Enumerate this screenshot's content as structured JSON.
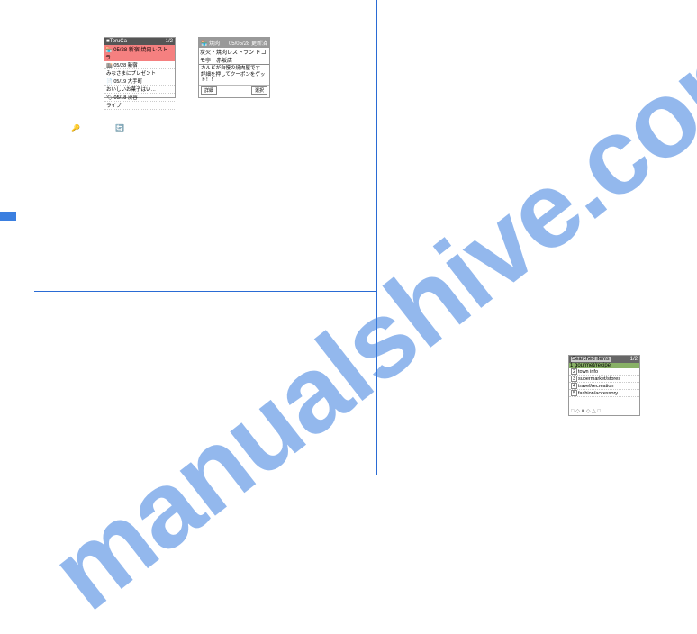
{
  "watermark": "manualshive.com",
  "ps1": {
    "titleLeft": "■ToruCa",
    "titleRight": "1/2",
    "hl": "🏪 05/28 新宿 焼肉レストラ…",
    "rows": [
      "🏬 05/28 新宿",
      "  みなさまにプレゼント",
      "📄 05/19 大手町",
      "  おいしいお菓子はい…",
      "🏷 05/18 渋谷",
      "  ライブ"
    ]
  },
  "ps2": {
    "titleLeft": "🏪 焼肉",
    "titleRight": "05/05/28 更新済",
    "hl": "炭火・焼肉レストラン ドコモ亭　赤坂店",
    "body": "カルビが自慢の焼肉屋です\n詳細を押してクーポンをゲット！！",
    "footLeft": "詳細",
    "footRight": "選択"
  },
  "ps3": {
    "titleLeft": "Searched items",
    "titleRight": "1/2",
    "hl": "1 gourmet/recipe",
    "rows": [
      {
        "n": "2",
        "t": "town info"
      },
      {
        "n": "3",
        "t": "supermarket/stores"
      },
      {
        "n": "4",
        "t": "travel/recreation"
      },
      {
        "n": "5",
        "t": "fashion/accessory"
      }
    ],
    "icons": "□ ◇ ■ ◇ △ □"
  },
  "miniIcons": {
    "a": "🔑",
    "b": "🔄"
  }
}
